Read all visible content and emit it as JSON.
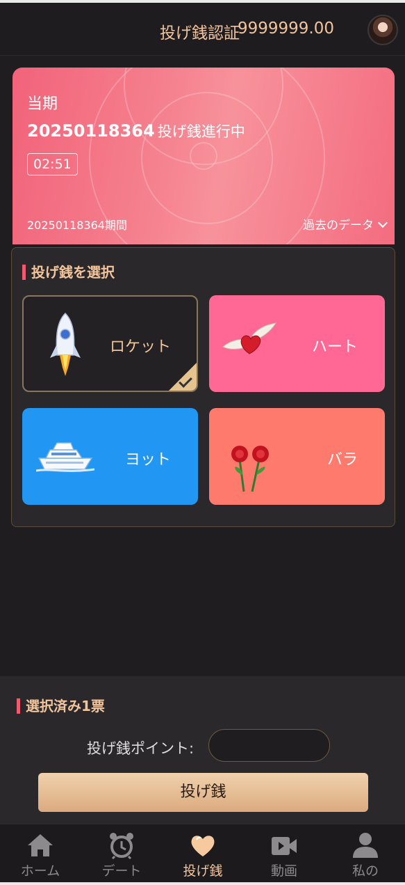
{
  "header": {
    "title": "投げ銭認証",
    "balance": "9999999.00"
  },
  "banner": {
    "period_label": "当期",
    "period_number": "20250118364",
    "period_status": "投げ銭進行中",
    "timer": "02:51",
    "period_footer": "20250118364期間",
    "history_label": "過去のデータ"
  },
  "select": {
    "title": "投げ銭を選択",
    "options": [
      {
        "label": "ロケット",
        "icon": "rocket-icon",
        "selected": true,
        "color": "#232124"
      },
      {
        "label": "ハート",
        "icon": "winged-heart-icon",
        "selected": false,
        "color": "#ff6895"
      },
      {
        "label": "ヨット",
        "icon": "yacht-icon",
        "selected": false,
        "color": "#2196f2"
      },
      {
        "label": "バラ",
        "icon": "roses-icon",
        "selected": false,
        "color": "#fe7a6c"
      }
    ]
  },
  "summary": {
    "title": "選択済み1票",
    "points_label": "投げ銭ポイント:",
    "points_value": "",
    "submit_label": "投げ銭"
  },
  "tabs": [
    {
      "label": "ホーム",
      "icon": "home-icon",
      "active": false
    },
    {
      "label": "デート",
      "icon": "alarm-clock-icon",
      "active": false
    },
    {
      "label": "投げ銭",
      "icon": "heart-icon",
      "active": true
    },
    {
      "label": "動画",
      "icon": "video-camera-icon",
      "active": false
    },
    {
      "label": "私の",
      "icon": "user-icon",
      "active": false
    }
  ],
  "colors": {
    "accent": "#f2c49c",
    "marker": "#ef5a6e",
    "background": "#1f1d20"
  }
}
